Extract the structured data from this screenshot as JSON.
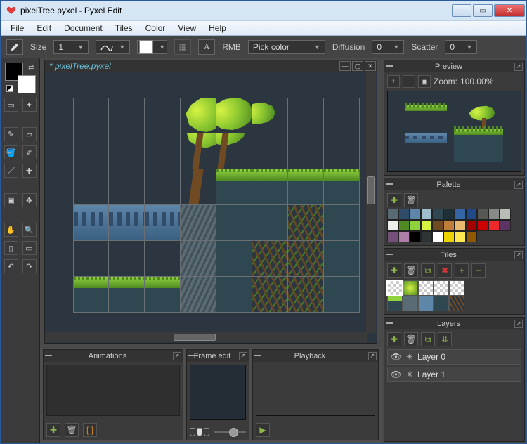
{
  "window": {
    "title": "pixelTree.pyxel - Pyxel Edit",
    "min": "—",
    "max": "▭",
    "close": "✕"
  },
  "menu": [
    "File",
    "Edit",
    "Document",
    "Tiles",
    "Color",
    "View",
    "Help"
  ],
  "toolbar": {
    "size_label": "Size",
    "size_value": "1",
    "rmb_label": "RMB",
    "rmb_value": "Pick color",
    "diff_label": "Diffusion",
    "diff_value": "0",
    "scatter_label": "Scatter",
    "scatter_value": "0"
  },
  "document": {
    "tab_name": "* pixelTree.pyxel"
  },
  "panels": {
    "animations": "Animations",
    "frame_edit": "Frame edit",
    "playback": "Playback",
    "preview": "Preview",
    "palette": "Palette",
    "tiles": "Tiles",
    "layers": "Layers"
  },
  "preview": {
    "zoom_label": "Zoom:",
    "zoom_value": "100.00%"
  },
  "palette_colors": [
    "#586b74",
    "#2f4d6b",
    "#5e86a8",
    "#9fbecd",
    "#2e4750",
    "#1f2f38",
    "#3465a4",
    "#204a87",
    "#555753",
    "#888a85",
    "#babdb6",
    "#eeeeec",
    "#4f8a22",
    "#8fd23d",
    "#d6f344",
    "#6f4a22",
    "#c17d3a",
    "#e9b96e",
    "#a40000",
    "#cc0000",
    "#ef2929",
    "#5c3566",
    "#75507b",
    "#ad7fa8",
    "#000000",
    "#2e3436",
    "#ffffff",
    "#edd400",
    "#fce94f",
    "#8f5902"
  ],
  "layers": {
    "items": [
      {
        "name": "Layer 0"
      },
      {
        "name": "Layer 1"
      }
    ]
  }
}
